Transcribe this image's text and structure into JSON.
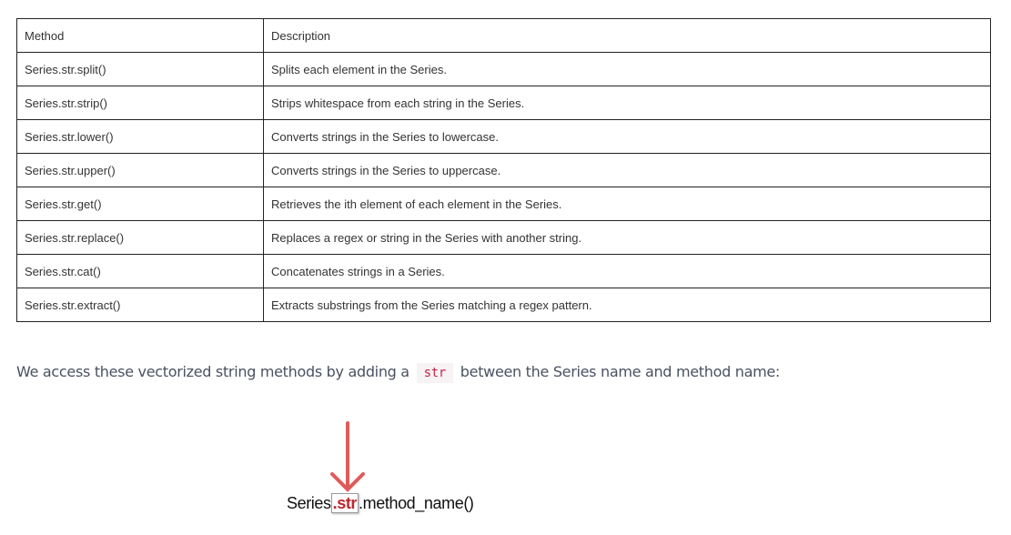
{
  "table": {
    "headers": [
      "Method",
      "Description"
    ],
    "rows": [
      [
        "Series.str.split()",
        "Splits each element in the Series."
      ],
      [
        "Series.str.strip()",
        "Strips whitespace from each string in the Series."
      ],
      [
        "Series.str.lower()",
        "Converts strings in the Series to lowercase."
      ],
      [
        "Series.str.upper()",
        "Converts strings in the Series to uppercase."
      ],
      [
        "Series.str.get()",
        "Retrieves the ith element of each element in the Series."
      ],
      [
        "Series.str.replace()",
        "Replaces a regex or string in the Series with another string."
      ],
      [
        "Series.str.cat()",
        "Concatenates strings in a Series."
      ],
      [
        "Series.str.extract()",
        "Extracts substrings from the Series matching a regex pattern."
      ]
    ]
  },
  "paragraph": {
    "before": "We access these vectorized string methods by adding a",
    "code": "str",
    "after": "between the Series name and method name:"
  },
  "diagram": {
    "prefix": "Series",
    "highlight": ".str",
    "suffix": ".method_name()",
    "arrow_color": "#e05a5a"
  }
}
